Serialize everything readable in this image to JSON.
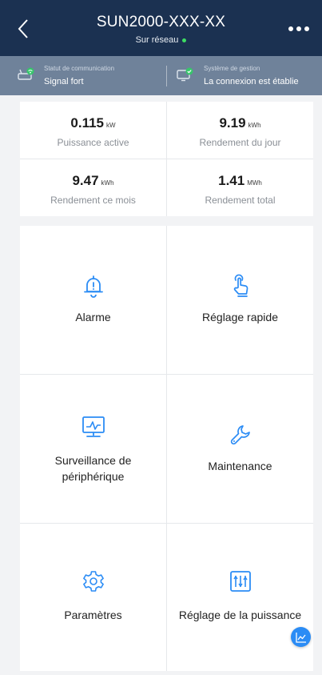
{
  "header": {
    "title": "SUN2000-XXX-XX",
    "subtitle": "Sur réseau",
    "online_color": "#3ddc62"
  },
  "status": {
    "communication": {
      "label": "Statut de communication",
      "value": "Signal fort",
      "icon": "router-signal-icon"
    },
    "management": {
      "label": "Système de gestion",
      "value": "La connexion est établie",
      "icon": "monitor-check-icon"
    }
  },
  "kpis": [
    {
      "value": "0.115",
      "unit": "kW",
      "label": "Puissance active"
    },
    {
      "value": "9.19",
      "unit": "kWh",
      "label": "Rendement du jour"
    },
    {
      "value": "9.47",
      "unit": "kWh",
      "label": "Rendement ce mois"
    },
    {
      "value": "1.41",
      "unit": "MWh",
      "label": "Rendement total"
    }
  ],
  "tiles": [
    {
      "label": "Alarme",
      "icon": "bell-alert-icon"
    },
    {
      "label": "Réglage rapide",
      "icon": "hand-tap-icon"
    },
    {
      "label": "Surveillance de périphérique",
      "label_line1": "Surveillance de",
      "label_line2": "périphérique",
      "icon": "monitor-chart-icon"
    },
    {
      "label": "Maintenance",
      "icon": "wrench-icon"
    },
    {
      "label": "Paramètres",
      "icon": "gear-icon"
    },
    {
      "label": "Réglage de la puissance",
      "icon": "sliders-icon"
    }
  ],
  "colors": {
    "header_bg": "#1b3151",
    "status_bg": "#6f829a",
    "accent": "#2b8cf5",
    "page_bg": "#f2f3f5"
  }
}
